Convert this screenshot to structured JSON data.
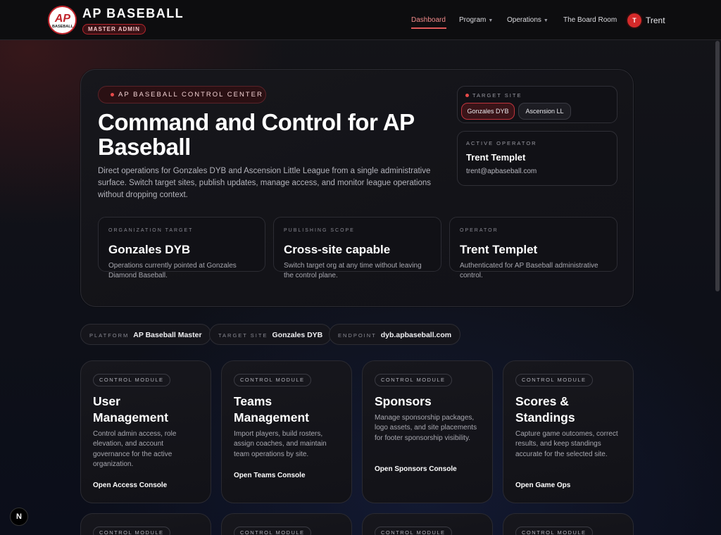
{
  "brand": {
    "title": "AP BASEBALL",
    "role_badge": "MASTER ADMIN",
    "logo_text_top": "AP",
    "logo_text_bottom": "BASEBALL"
  },
  "nav": {
    "items": [
      "Dashboard",
      "Program",
      "Operations",
      "The Board Room"
    ],
    "user_initial": "T",
    "user_name": "Trent"
  },
  "hero": {
    "tag": "AP BASEBALL CONTROL CENTER",
    "title": "Command and Control for AP Baseball",
    "description": "Direct operations for Gonzales DYB and Ascension Little League from a single administrative surface. Switch target sites, publish updates, manage access, and monitor league operations without dropping context.",
    "target_site": {
      "label": "TARGET SITE",
      "options": [
        "Gonzales DYB",
        "Ascension LL"
      ],
      "selected": "Gonzales DYB"
    },
    "operator": {
      "label": "ACTIVE OPERATOR",
      "name": "Trent Templet",
      "email": "trent@apbaseball.com"
    },
    "stats": [
      {
        "label": "ORGANIZATION TARGET",
        "value": "Gonzales DYB",
        "desc": "Operations currently pointed at Gonzales Diamond Baseball."
      },
      {
        "label": "PUBLISHING SCOPE",
        "value": "Cross-site capable",
        "desc": "Switch target org at any time without leaving the control plane."
      },
      {
        "label": "OPERATOR",
        "value": "Trent Templet",
        "desc": "Authenticated for AP Baseball administrative control."
      }
    ]
  },
  "meta": [
    {
      "key": "PLATFORM",
      "value": "AP Baseball Master"
    },
    {
      "key": "TARGET SITE",
      "value": "Gonzales DYB"
    },
    {
      "key": "ENDPOINT",
      "value": "dyb.apbaseball.com"
    }
  ],
  "modules": [
    {
      "tag": "CONTROL MODULE",
      "title": "User Management",
      "desc": "Control admin access, role elevation, and account governance for the active organization.",
      "link": "Open Access Console"
    },
    {
      "tag": "CONTROL MODULE",
      "title": "Teams Management",
      "desc": "Import players, build rosters, assign coaches, and maintain team operations by site.",
      "link": "Open Teams Console"
    },
    {
      "tag": "CONTROL MODULE",
      "title": "Sponsors",
      "desc": "Manage sponsorship packages, logo assets, and site placements for footer sponsorship visibility.",
      "link": "Open Sponsors Console"
    },
    {
      "tag": "CONTROL MODULE",
      "title": "Scores & Standings",
      "desc": "Capture game outcomes, correct results, and keep standings accurate for the selected site.",
      "link": "Open Game Ops"
    }
  ],
  "modules_row2_tags": [
    "CONTROL MODULE",
    "CONTROL MODULE",
    "CONTROL MODULE",
    "CONTROL MODULE"
  ],
  "dev_badge": "N",
  "colors": {
    "accent": "#e05a5a",
    "brand_red": "#c0242b"
  }
}
